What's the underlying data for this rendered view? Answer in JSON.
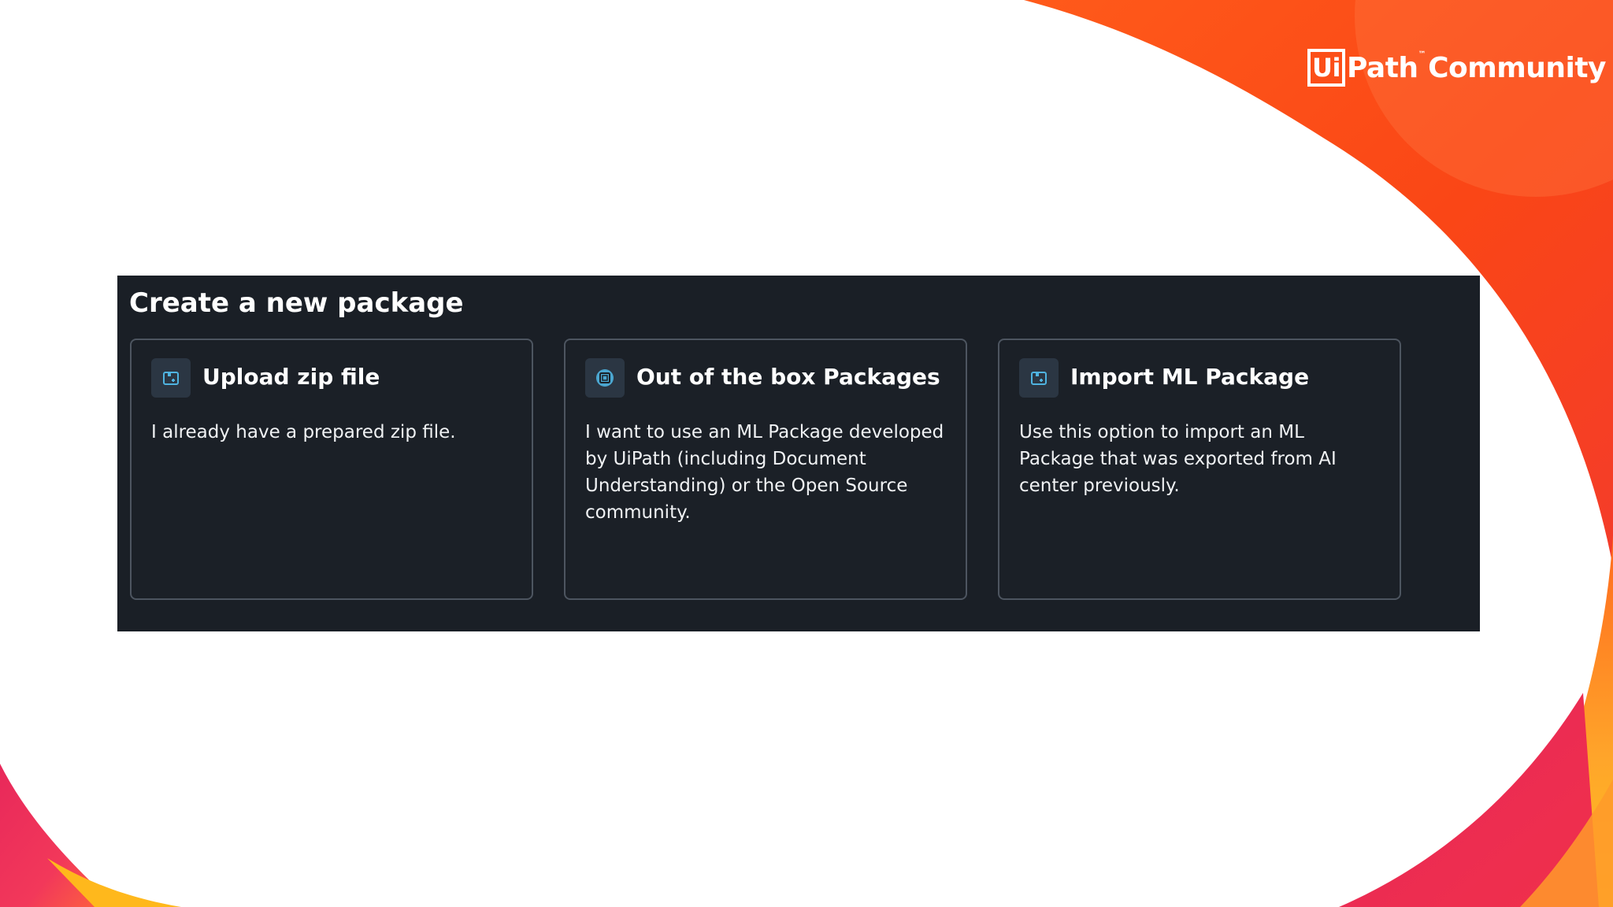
{
  "logo": {
    "ui": "Ui",
    "path": "Path",
    "tm": "™",
    "community": "Community"
  },
  "panel": {
    "title": "Create a new package",
    "cards": [
      {
        "title": "Upload zip file",
        "description": "I already have a prepared zip file.",
        "icon": "package-icon"
      },
      {
        "title": "Out of the box Packages",
        "description": "I want to use an ML Package developed by UiPath (including Document Understanding) or the Open Source community.",
        "icon": "ml-package-icon"
      },
      {
        "title": "Import ML Package",
        "description": "Use this option to import an ML Package that was exported from AI center previously.",
        "icon": "package-icon"
      }
    ]
  },
  "colors": {
    "panel_bg": "#1a1f26",
    "card_border": "#4d5560",
    "icon_accent": "#4fb3e0",
    "brand_orange": "#fa4616",
    "brand_pink": "#e8285a",
    "brand_yellow": "#ffb81c"
  }
}
